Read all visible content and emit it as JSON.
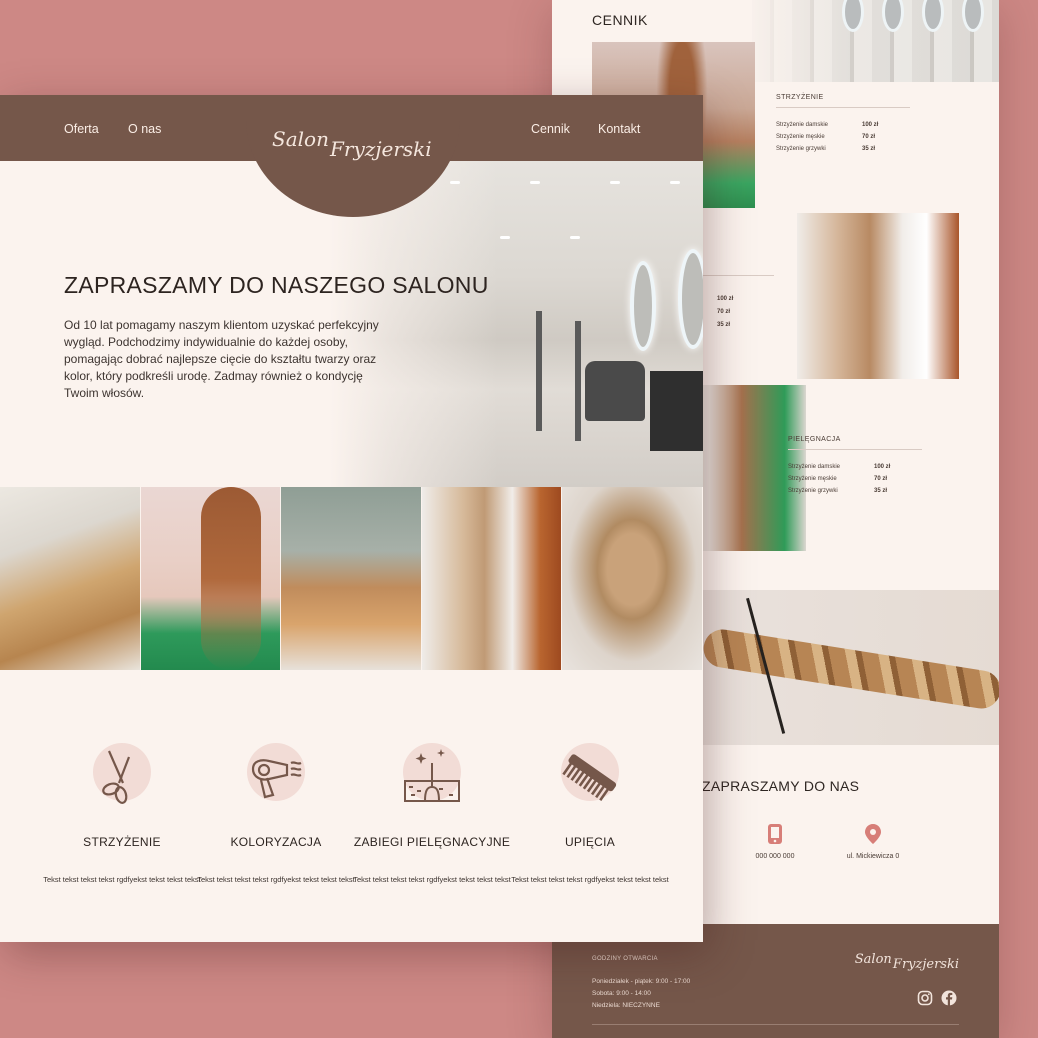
{
  "colors": {
    "background": "#cd8885",
    "page": "#fbf3ee",
    "brand_brown": "#75574a",
    "icon_circle": "#f2dcd6"
  },
  "back": {
    "cennik_title": "CENNIK",
    "price_groups": [
      {
        "heading": "STRZYŻENIE",
        "rows": [
          {
            "name": "Strzyżenie damskie",
            "price": "100 zł"
          },
          {
            "name": "Strzyżenie męskie",
            "price": "70 zł"
          },
          {
            "name": "Strzyżenie grzywki",
            "price": "35 zł"
          }
        ]
      },
      {
        "heading": "PIELĘGNACJA",
        "rows": [
          {
            "name": "Strzyżenie damskie",
            "price": "100 zł"
          },
          {
            "name": "Strzyżenie męskie",
            "price": "70 zł"
          },
          {
            "name": "Strzyżenie grzywki",
            "price": "35 zł"
          }
        ]
      }
    ],
    "partial_prices": [
      "100 zł",
      "70 zł",
      "35 zł"
    ],
    "zapraszamy": "ZAPRASZAMY DO NAS",
    "contact": {
      "phone": "000 000 000",
      "address": "ul. Mickiewicza 0",
      "phone_icon": "phone-icon",
      "address_icon": "location-pin-icon"
    },
    "footer": {
      "hours_heading": "GODZINY OTWARCIA",
      "hours": [
        "Poniedziałek - piątek: 9:00 - 17:00",
        "Sobota: 9:00 - 14:00",
        "Niedziela: NIECZYNNE"
      ],
      "logo_w1": "Salon",
      "logo_w2": "Fryzjerski",
      "social": [
        "instagram-icon",
        "facebook-icon"
      ]
    }
  },
  "front": {
    "nav": {
      "left": [
        "Oferta",
        "O nas"
      ],
      "right": [
        "Cennik",
        "Kontakt"
      ]
    },
    "logo": {
      "w1": "Salon",
      "w2": "Fryzjerski"
    },
    "hero": {
      "title": "ZAPRASZAMY DO NASZEGO SALONU",
      "text": "Od 10 lat pomagamy naszym klientom uzyskać perfekcyjny wygląd. Podchodzimy indywidualnie do każdej osoby, pomagając dobrać najlepsze cięcie do kształtu twarzy oraz kolor, który podkreśli urodę. Zadmay również o kondycję Twoim włosów."
    },
    "services": [
      {
        "icon": "scissors-icon",
        "name": "STRZYŻENIE",
        "desc": "Tekst tekst tekst tekst rgdfyekst tekst tekst tekst"
      },
      {
        "icon": "hair-dryer-icon",
        "name": "KOLORYZACJA",
        "desc": "Tekst tekst tekst tekst rgdfyekst tekst tekst tekst"
      },
      {
        "icon": "hair-follicle-icon",
        "name": "ZABIEGI PIELĘGNACYJNE",
        "desc": "Tekst tekst tekst tekst rgdfyekst tekst tekst tekst"
      },
      {
        "icon": "comb-icon",
        "name": "UPIĘCIA",
        "desc": "Tekst tekst tekst tekst rgdfyekst tekst tekst tekst"
      }
    ]
  }
}
